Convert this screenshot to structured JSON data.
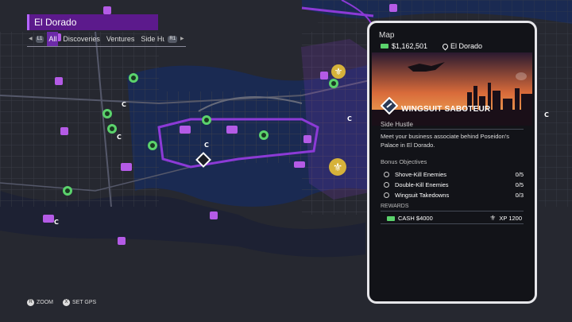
{
  "header": {
    "location": "El Dorado"
  },
  "filter": {
    "left_button": "L1",
    "right_button": "R1",
    "tabs": [
      "All",
      "Discoveries",
      "Ventures",
      "Side Hu"
    ],
    "active_tab": "All"
  },
  "hints": {
    "zoom_button": "R",
    "zoom_label": "ZOOM",
    "gps_button": "X",
    "gps_label": "SET GPS"
  },
  "panel": {
    "title": "Map",
    "money": "$1,162,501",
    "location": "El Dorado",
    "mission": {
      "title": "WINGSUIT SABOTEUR",
      "type": "Side Hustle",
      "description": "Meet your business associate behind Poseidon's Palace in El Dorado."
    },
    "bonus_heading": "Bonus Objectives",
    "objectives": [
      {
        "label": "Shove-Kill Enemies",
        "count": "0/5"
      },
      {
        "label": "Double-Kill Enemies",
        "count": "0/5"
      },
      {
        "label": "Wingsuit Takedowns",
        "count": "0/3"
      }
    ],
    "rewards_heading": "REWARDS",
    "rewards": [
      {
        "icon": "cash-icon",
        "label": "CASH $4000"
      },
      {
        "icon": "fleur-de-lis-icon",
        "label": "XP 1200"
      }
    ]
  },
  "map": {
    "marker_letter": "C",
    "colors": {
      "district_highlight": "#8c3ad6",
      "water": "#1a2a52",
      "land": "#2a2c33",
      "venture_marker": "#5bd36c",
      "activity_marker": "#b45be6",
      "gold_marker": "#d6b23a"
    }
  }
}
